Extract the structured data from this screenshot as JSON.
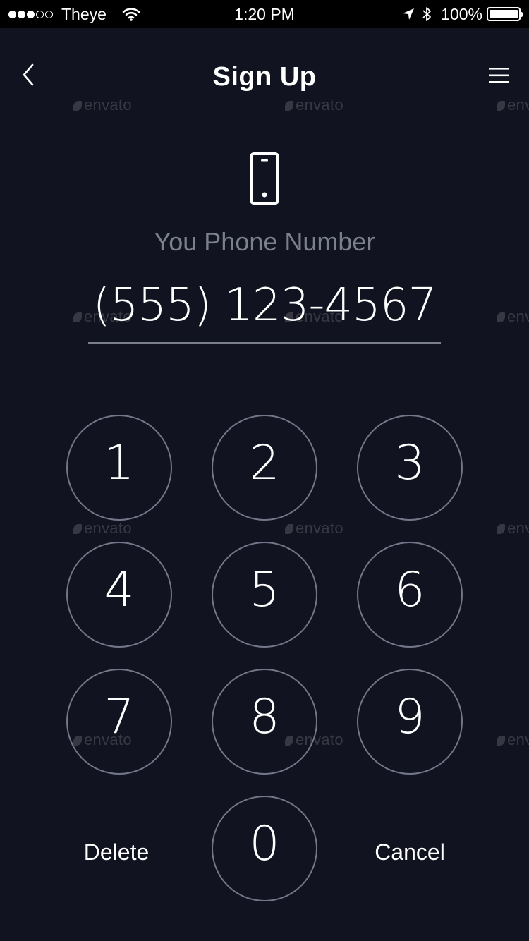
{
  "status_bar": {
    "carrier": "Theye",
    "time": "1:20 PM",
    "battery": "100%",
    "signal_dots": [
      true,
      true,
      true,
      false,
      false
    ],
    "icons": [
      "wifi-icon",
      "location-arrow-icon",
      "bluetooth-icon",
      "battery-icon"
    ]
  },
  "header": {
    "title": "Sign Up",
    "back_icon": "chevron-left-icon",
    "menu_icon": "hamburger-menu-icon"
  },
  "watermark": "envato",
  "phone": {
    "icon": "smartphone-icon",
    "label": "You Phone Number",
    "value": "(555) 123-4567"
  },
  "keypad": {
    "keys": [
      "1",
      "2",
      "3",
      "4",
      "5",
      "6",
      "7",
      "8",
      "9",
      "0"
    ],
    "delete_label": "Delete",
    "cancel_label": "Cancel"
  },
  "colors": {
    "background": "#111320",
    "status_bar": "#000000",
    "muted_text": "#7c7f8e",
    "key_border": "#74768a"
  }
}
